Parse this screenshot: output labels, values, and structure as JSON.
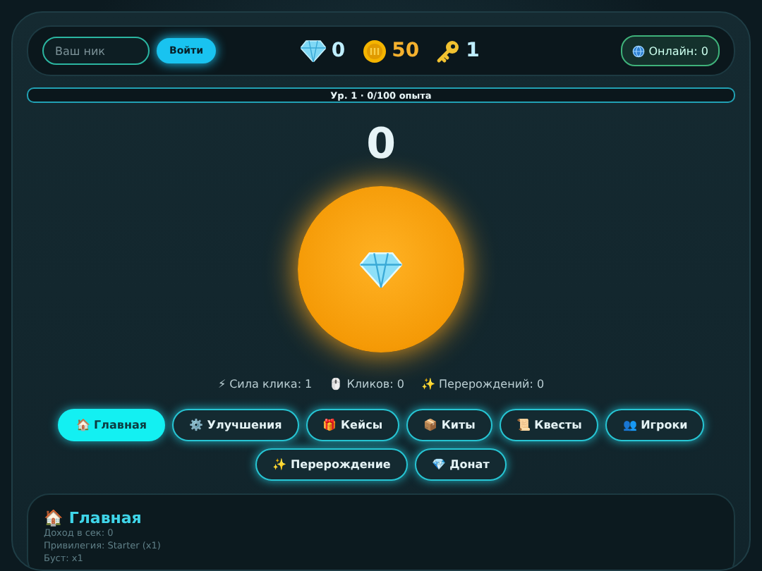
{
  "header": {
    "nick_field": {
      "placeholder": "Ваш ник"
    },
    "login_button": "Войти",
    "currencies": [
      {
        "kind": "gem",
        "value": "0"
      },
      {
        "kind": "coin",
        "value": "50"
      },
      {
        "kind": "key",
        "value": "1"
      }
    ],
    "online": "Онлайн: 0"
  },
  "xp_bar": {
    "label": "Ур. 1 · 0/100 опыта"
  },
  "score": "0",
  "stats": [
    "⚡ Сила клика: 1",
    "🖱️ Кликов: 0",
    "✨ Перерождений: 0"
  ],
  "tabs": [
    {
      "label": "🏠 Главная",
      "selected": true
    },
    {
      "label": "⚙️ Улучшения",
      "selected": false
    },
    {
      "label": "🎁 Кейсы",
      "selected": false
    },
    {
      "label": "📦 Киты",
      "selected": false
    },
    {
      "label": "📜 Квесты",
      "selected": false
    },
    {
      "label": "👥 Игроки",
      "selected": false
    },
    {
      "label": "✨ Перерождение",
      "selected": false
    },
    {
      "label": "💎 Донат",
      "selected": false
    }
  ],
  "section": {
    "title": "🏠 Главная",
    "lines": [
      "Доход в сек: 0",
      "Привилегия: Starter (x1)",
      "Буст: x1"
    ]
  }
}
